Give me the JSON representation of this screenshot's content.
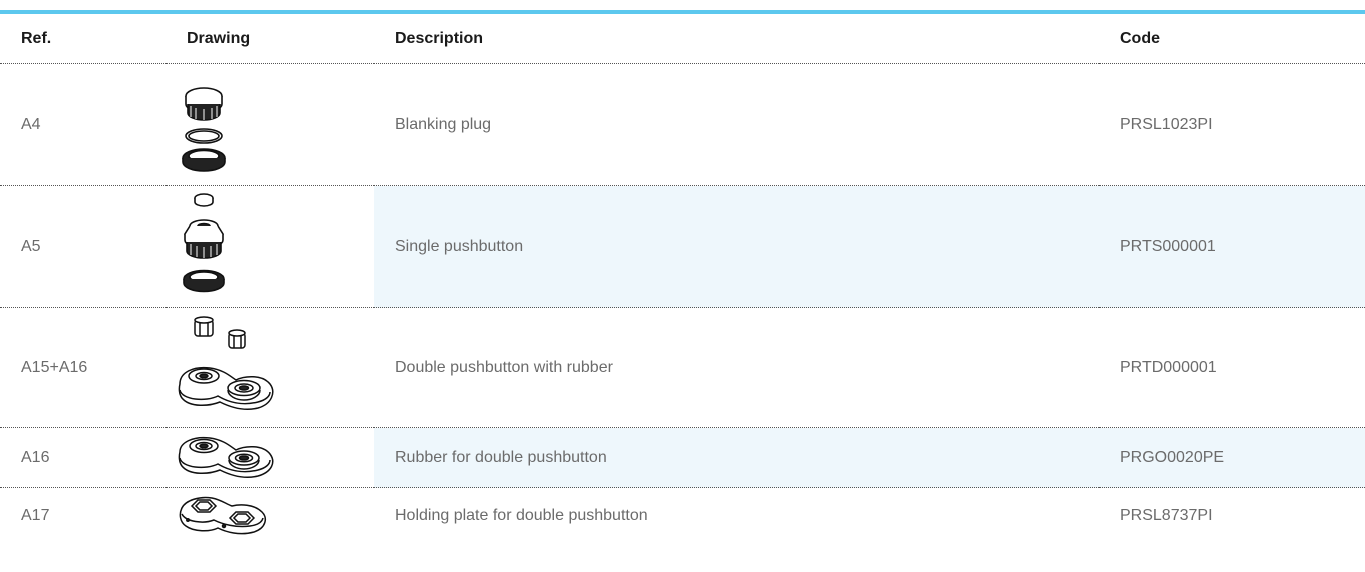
{
  "table": {
    "headers": {
      "ref": "Ref.",
      "drawing": "Drawing",
      "description": "Description",
      "code": "Code"
    },
    "rows": [
      {
        "ref": "A4",
        "description": "Blanking plug",
        "code": "PRSL1023PI",
        "drawing_icon": "blanking-plug-drawing-icon",
        "shaded": false
      },
      {
        "ref": "A5",
        "description": "Single pushbutton",
        "code": "PRTS000001",
        "drawing_icon": "single-pushbutton-drawing-icon",
        "shaded": true
      },
      {
        "ref": "A15+A16",
        "description": "Double pushbutton with rubber",
        "code": "PRTD000001",
        "drawing_icon": "double-pushbutton-with-rubber-drawing-icon",
        "shaded": false
      },
      {
        "ref": "A16",
        "description": "Rubber for double pushbutton",
        "code": "PRGO0020PE",
        "drawing_icon": "rubber-double-pushbutton-drawing-icon",
        "shaded": true
      },
      {
        "ref": "A17",
        "description": "Holding plate for double pushbutton",
        "code": "PRSL8737PI",
        "drawing_icon": "holding-plate-drawing-icon",
        "shaded": false
      }
    ]
  },
  "colors": {
    "accent_bar": "#5cc8ee",
    "row_highlight": "#eef7fc",
    "header_text": "#1a1a1a",
    "body_text": "#6b6b6b"
  }
}
